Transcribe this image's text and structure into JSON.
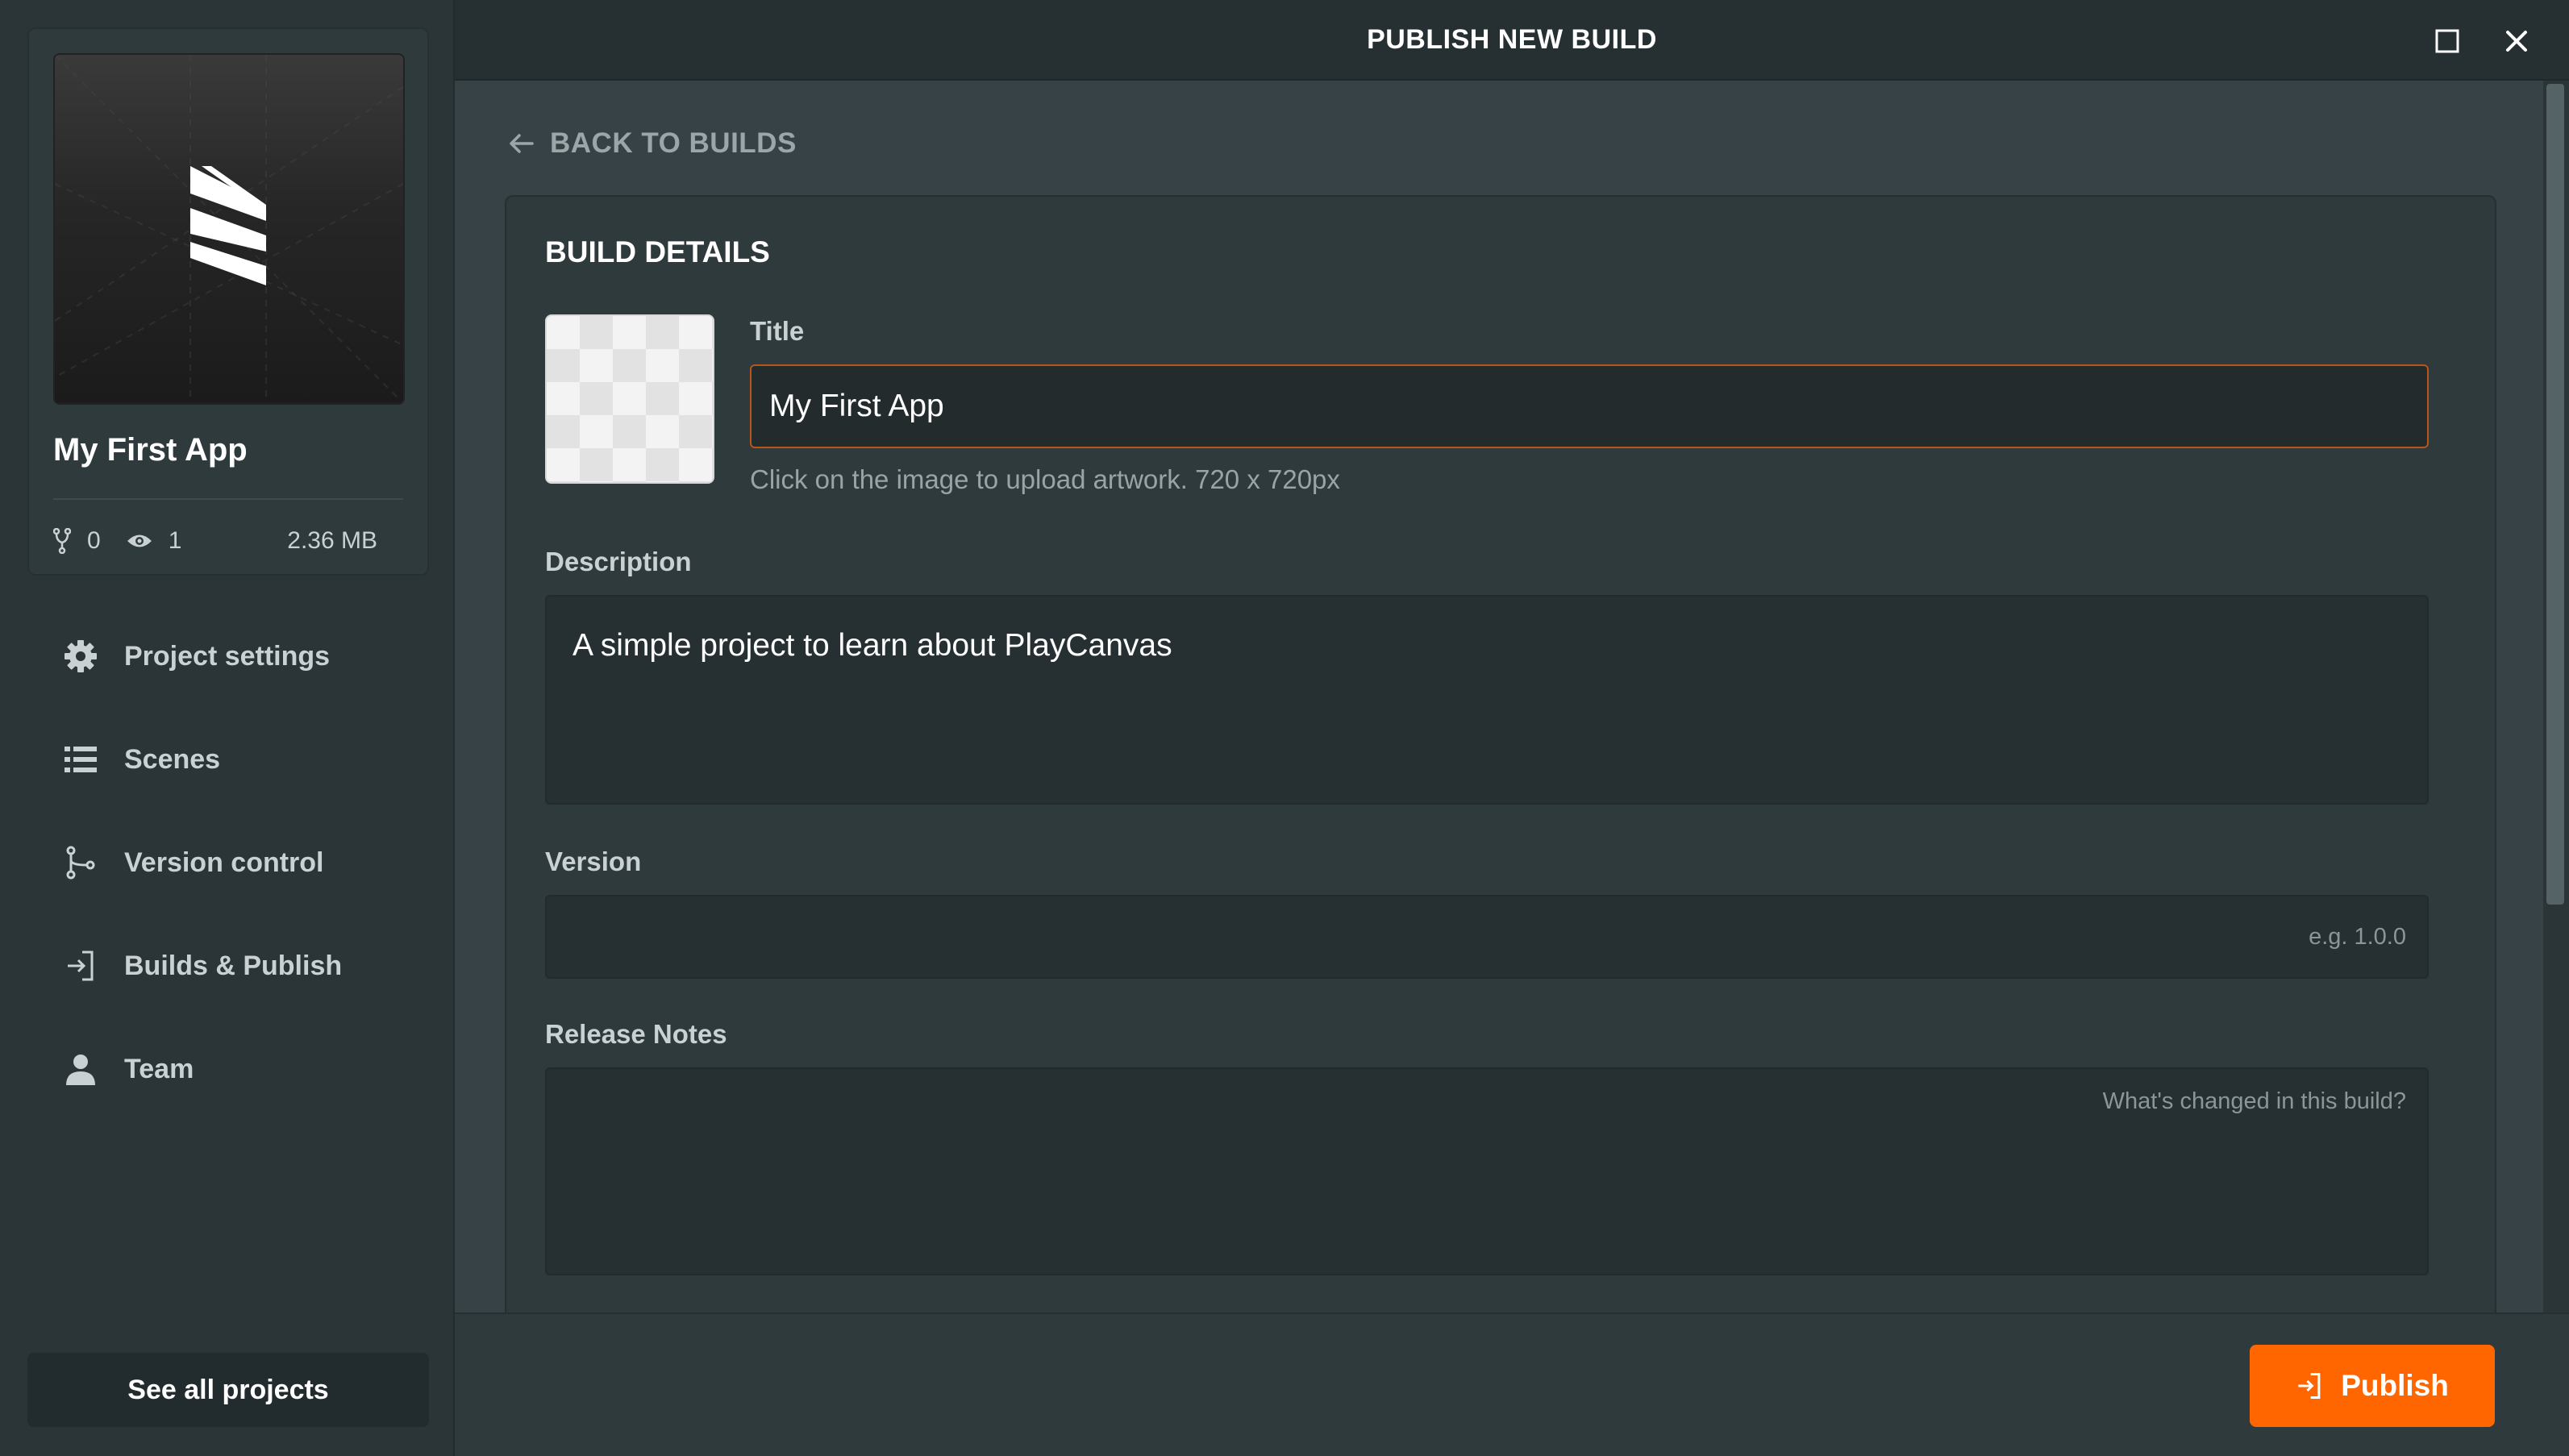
{
  "dialog": {
    "title": "PUBLISH NEW BUILD",
    "back_label": "BACK TO BUILDS",
    "section_title": "BUILD DETAILS"
  },
  "project": {
    "name": "My First App",
    "forks": "0",
    "views": "1",
    "size": "2.36 MB"
  },
  "sidebar": {
    "items": [
      {
        "label": "Project settings",
        "icon": "gear-icon"
      },
      {
        "label": "Scenes",
        "icon": "list-icon"
      },
      {
        "label": "Version control",
        "icon": "branch-icon"
      },
      {
        "label": "Builds & Publish",
        "icon": "publish-icon"
      },
      {
        "label": "Team",
        "icon": "user-icon"
      }
    ],
    "see_all_label": "See all projects"
  },
  "form": {
    "title_label": "Title",
    "title_value": "My First App",
    "artwork_hint": "Click on the image to upload artwork. 720 x 720px",
    "description_label": "Description",
    "description_value": "A simple project to learn about PlayCanvas",
    "version_label": "Version",
    "version_value": "",
    "version_placeholder": "e.g. 1.0.0",
    "notes_label": "Release Notes",
    "notes_value": "",
    "notes_placeholder": "What's changed in this build?"
  },
  "footer": {
    "publish_label": "Publish"
  },
  "colors": {
    "accent": "#ff6600",
    "focus_border": "#b5561a",
    "background": "#364245"
  }
}
